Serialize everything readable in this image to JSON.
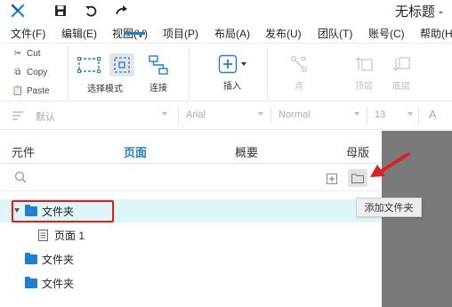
{
  "window": {
    "title": "无标题 -"
  },
  "menu": [
    "文件(F)",
    "编辑(E)",
    "视图(V)",
    "项目(P)",
    "布局(A)",
    "发布(U)",
    "团队(T)",
    "账号(C)",
    "帮助(H"
  ],
  "clipboard": {
    "cut": "Cut",
    "copy": "Copy",
    "paste": "Paste"
  },
  "ribbon": {
    "select_mode": "选择模式",
    "connect": "连接",
    "insert": "插入",
    "point": "点",
    "top_layer": "顶层",
    "bottom_layer": "底层"
  },
  "format": {
    "style": "默认",
    "font": "Arial",
    "weight": "Normal",
    "size": "13",
    "text_icon": "A"
  },
  "panel": {
    "tabs": [
      "元件",
      "页面",
      "概要",
      "母版"
    ],
    "active_tab": "页面",
    "tooltip": "添加文件夹",
    "tree": [
      {
        "label": "文件夹",
        "type": "folder",
        "selected": true
      },
      {
        "label": "页面 1",
        "type": "page"
      },
      {
        "label": "文件夹",
        "type": "folder"
      },
      {
        "label": "文件夹",
        "type": "folder"
      }
    ]
  },
  "colors": {
    "accent": "#1f7fd0",
    "highlight_red": "#e02020",
    "selected_row": "#dff6f8",
    "canvas_gray": "#7a7a7a"
  }
}
